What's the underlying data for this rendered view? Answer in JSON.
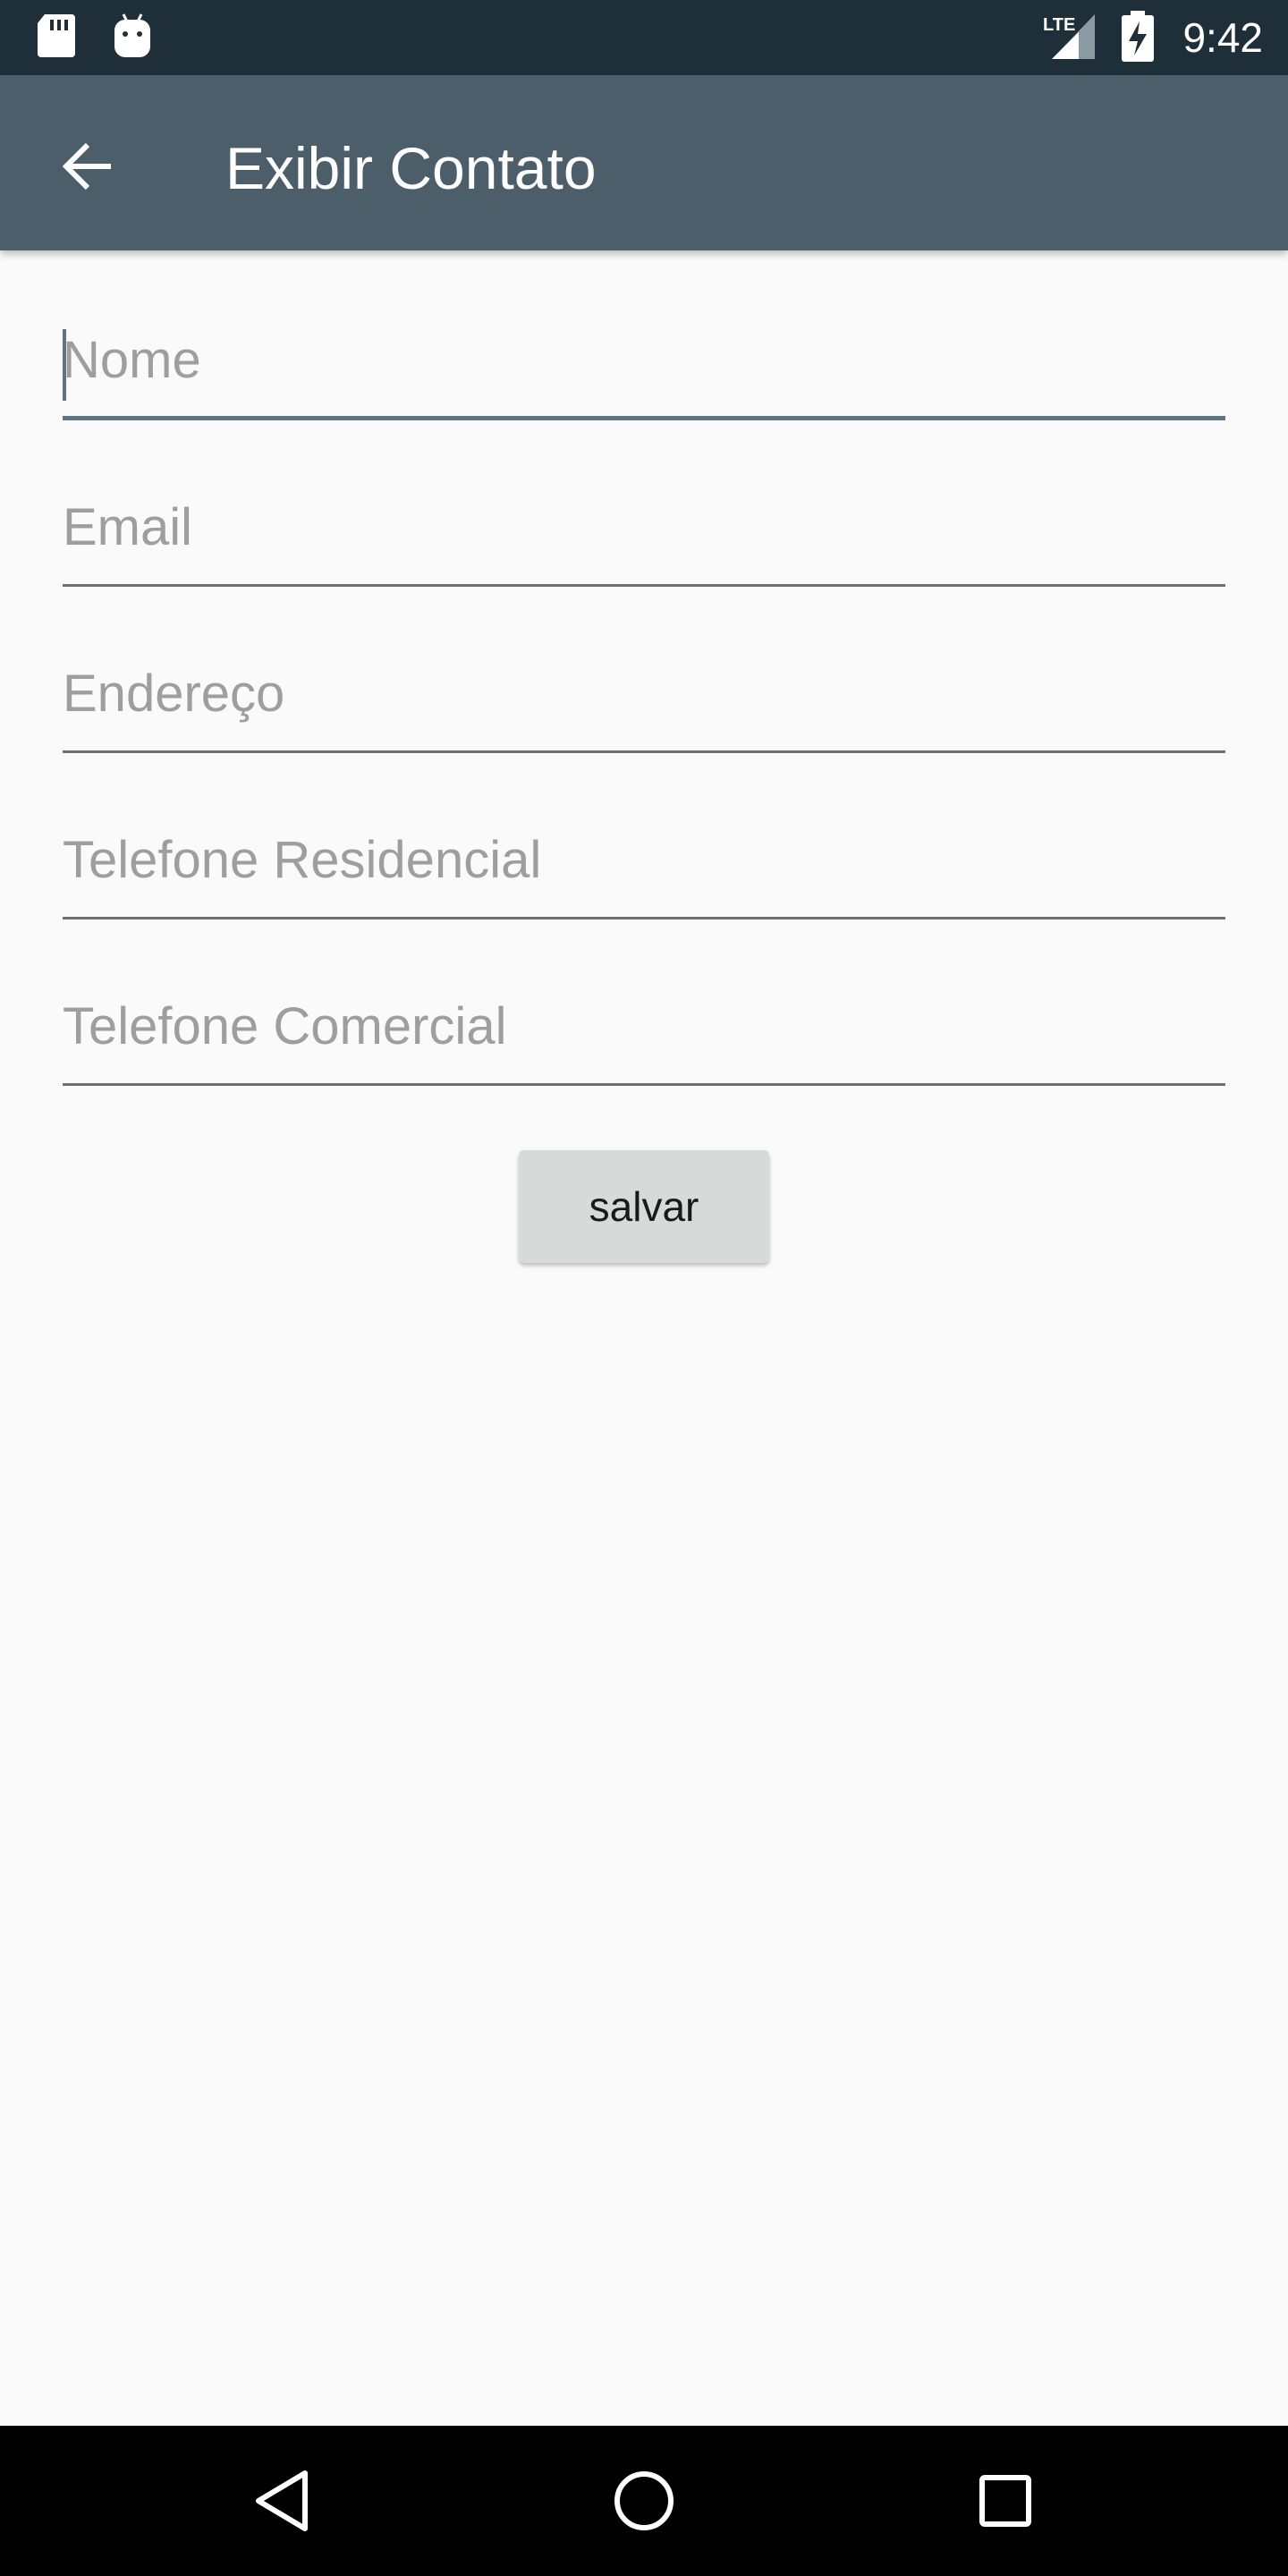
{
  "status_bar": {
    "time": "9:42",
    "icons": [
      "sd-card-icon",
      "android-icon",
      "lte-signal-icon",
      "battery-charging-icon"
    ],
    "network_label": "LTE"
  },
  "app_bar": {
    "title": "Exibir Contato",
    "back_icon": "arrow-back-icon"
  },
  "form": {
    "fields": [
      {
        "placeholder": "Nome",
        "value": ""
      },
      {
        "placeholder": "Email",
        "value": ""
      },
      {
        "placeholder": "Endereço",
        "value": ""
      },
      {
        "placeholder": "Telefone Residencial",
        "value": ""
      },
      {
        "placeholder": "Telefone Comercial",
        "value": ""
      }
    ],
    "save_label": "salvar"
  },
  "nav_bar": {
    "icons": [
      "back-triangle-icon",
      "home-circle-icon",
      "recents-square-icon"
    ]
  },
  "colors": {
    "status_bar": "#1f2f3a",
    "app_bar": "#4b5e6a",
    "background": "#fafafa",
    "accent": "#5e7482"
  }
}
